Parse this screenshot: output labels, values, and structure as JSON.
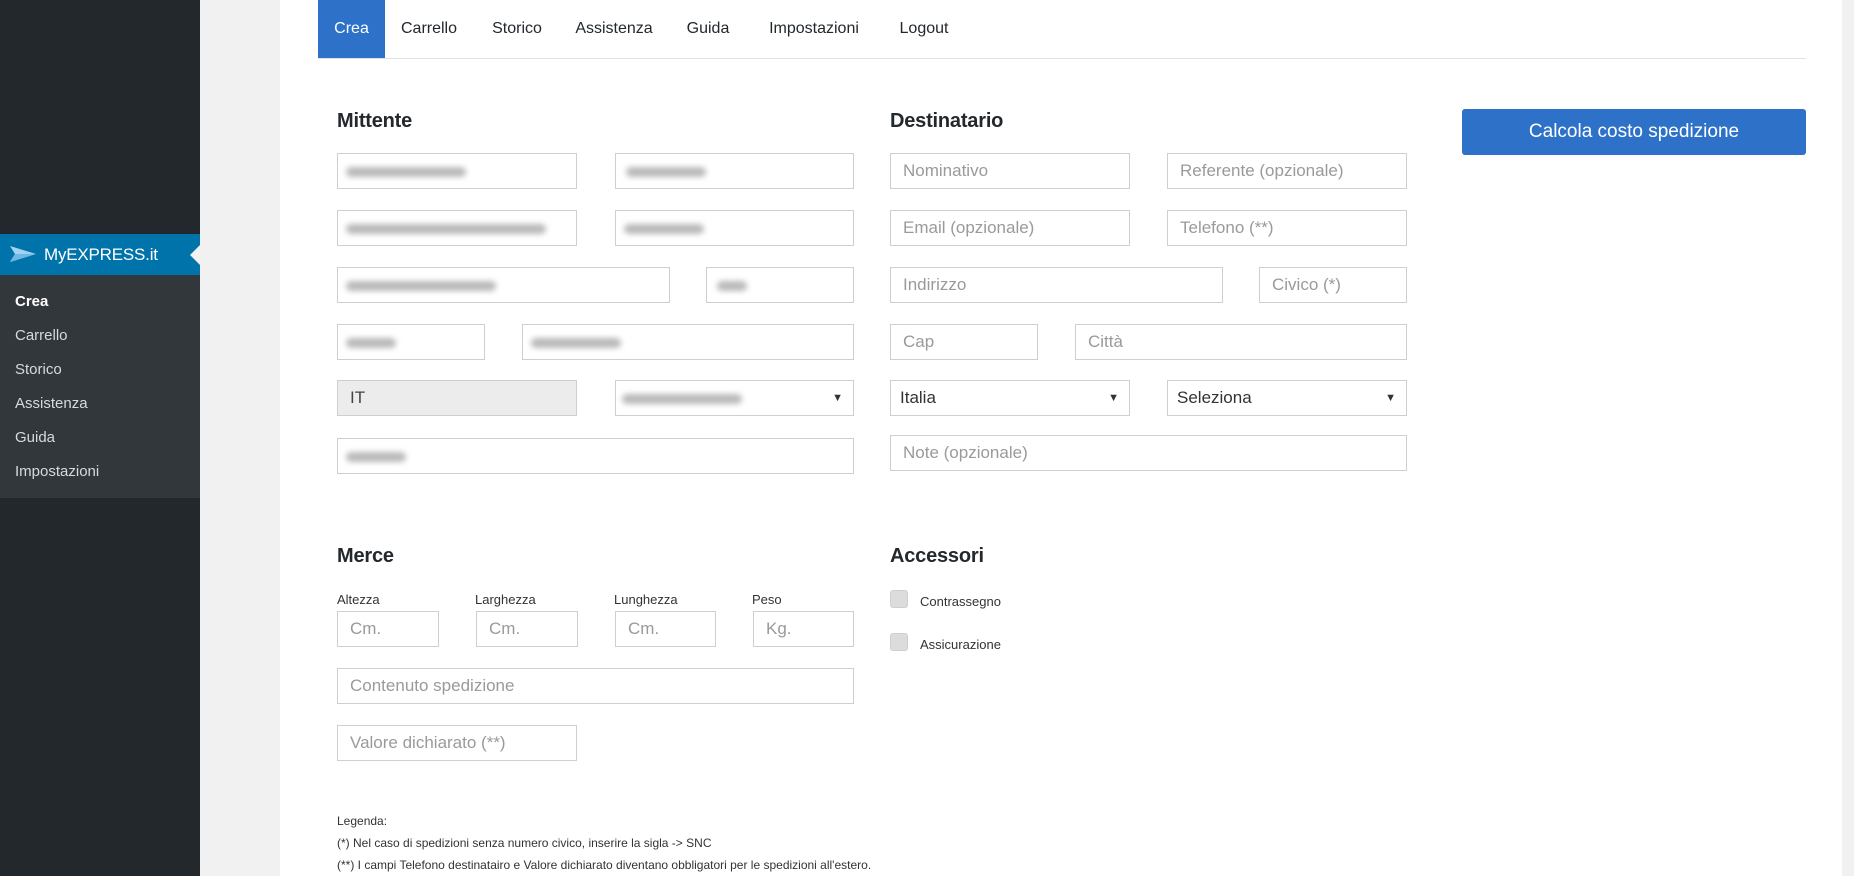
{
  "brand": {
    "name": "MyEXPRESS.it"
  },
  "sidebar": {
    "items": [
      {
        "label": "Crea",
        "active": true
      },
      {
        "label": "Carrello"
      },
      {
        "label": "Storico"
      },
      {
        "label": "Assistenza"
      },
      {
        "label": "Guida"
      },
      {
        "label": "Impostazioni"
      }
    ]
  },
  "tabs": [
    {
      "label": "Crea",
      "active": true
    },
    {
      "label": "Carrello"
    },
    {
      "label": "Storico"
    },
    {
      "label": "Assistenza"
    },
    {
      "label": "Guida"
    },
    {
      "label": "Impostazioni"
    },
    {
      "label": "Logout"
    }
  ],
  "mittente": {
    "title": "Mittente",
    "country_code": "IT"
  },
  "destinatario": {
    "title": "Destinatario",
    "nominativo_placeholder": "Nominativo",
    "referente_placeholder": "Referente (opzionale)",
    "email_placeholder": "Email (opzionale)",
    "telefono_placeholder": "Telefono (**)",
    "indirizzo_placeholder": "Indirizzo",
    "civico_placeholder": "Civico (*)",
    "cap_placeholder": "Cap",
    "citta_placeholder": "Città",
    "paese_selected": "Italia",
    "provincia_selected": "Seleziona",
    "note_placeholder": "Note (opzionale)"
  },
  "calc_button": "Calcola costo spedizione",
  "merce": {
    "title": "Merce",
    "altezza_label": "Altezza",
    "larghezza_label": "Larghezza",
    "lunghezza_label": "Lunghezza",
    "peso_label": "Peso",
    "cm_placeholder": "Cm.",
    "kg_placeholder": "Kg.",
    "contenuto_placeholder": "Contenuto spedizione",
    "valore_placeholder": "Valore dichiarato (**)"
  },
  "accessori": {
    "title": "Accessori",
    "contrassegno": "Contrassegno",
    "assicurazione": "Assicurazione"
  },
  "legend": {
    "title": "Legenda:",
    "note1": "(*) Nel caso di spedizioni senza numero civico, inserire la sigla -> SNC",
    "note2": "(**) I campi Telefono destinatairo e Valore dichiarato diventano obbligatori per le spedizioni all'estero."
  },
  "icons": {
    "brand_logo": "paper-plane-icon",
    "select_caret": "caret-down-icon"
  },
  "colors": {
    "sidebar": "#23282d",
    "submenu": "#32373c",
    "accent": "#2d72c8",
    "brand": "#0073aa"
  }
}
